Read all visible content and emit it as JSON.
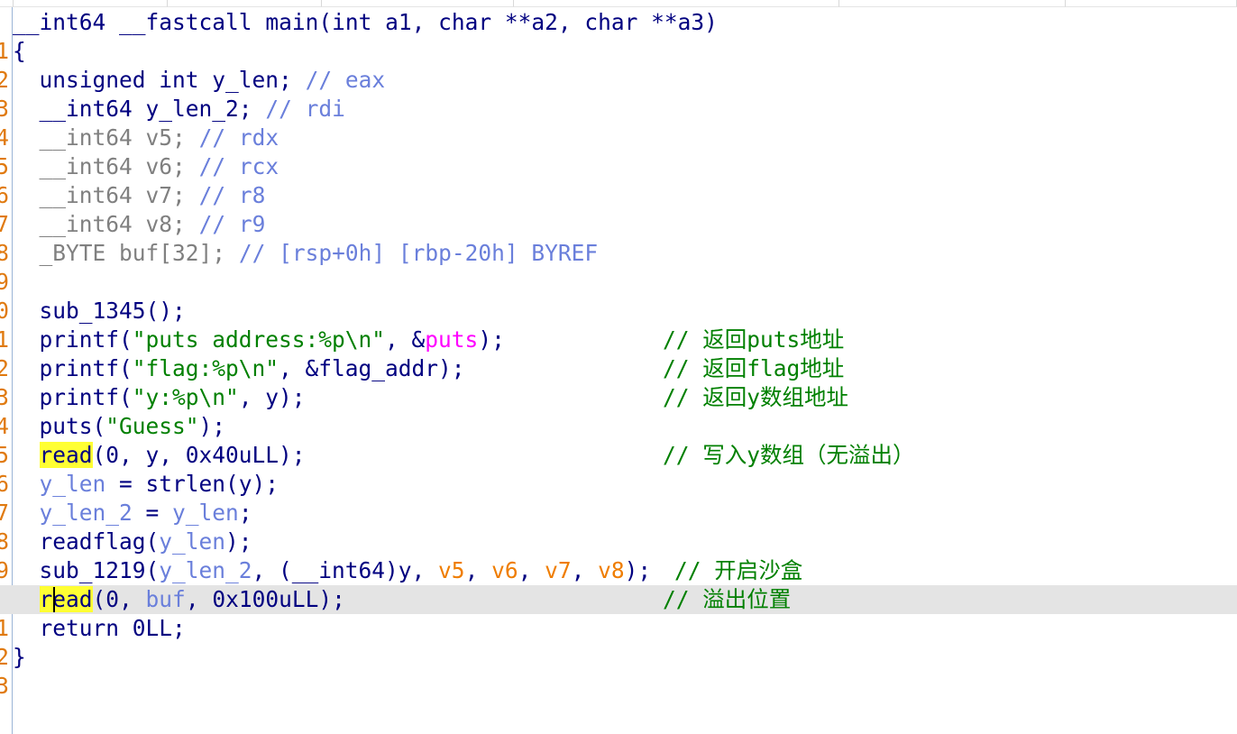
{
  "signature": {
    "ret": "__int64",
    "conv": "__fastcall",
    "rest": "main(int a1, char **a2, char **a3)"
  },
  "line_numbers": [
    "1",
    "2",
    "3",
    "4",
    "5",
    "6",
    "7",
    "8",
    "9",
    "0",
    "1",
    "2",
    "3",
    "4",
    "5",
    "6",
    "7",
    "8",
    "9",
    "0",
    "1",
    "2",
    "3"
  ],
  "decls": [
    {
      "type": "unsigned int",
      "name": "y_len;",
      "comment": "// eax"
    },
    {
      "type": "__int64",
      "name": "y_len_2;",
      "comment": "// rdi"
    },
    {
      "type": "__int64",
      "name": "v5;",
      "comment": "// rdx"
    },
    {
      "type": "__int64",
      "name": "v6;",
      "comment": "// rcx"
    },
    {
      "type": "__int64",
      "name": "v7;",
      "comment": "// r8"
    },
    {
      "type": "__int64",
      "name": "v8;",
      "comment": "// r9"
    },
    {
      "type": "_BYTE",
      "name": "buf[32];",
      "comment": "// [rsp+0h] [rbp-20h] BYREF"
    }
  ],
  "comments": {
    "puts": "// 返回puts地址",
    "flag": "// 返回flag地址",
    "y": "// 返回y数组地址",
    "read_y": "// 写入y数组（无溢出）",
    "sandbox": "// 开启沙盒",
    "overflow": "// 溢出位置"
  }
}
